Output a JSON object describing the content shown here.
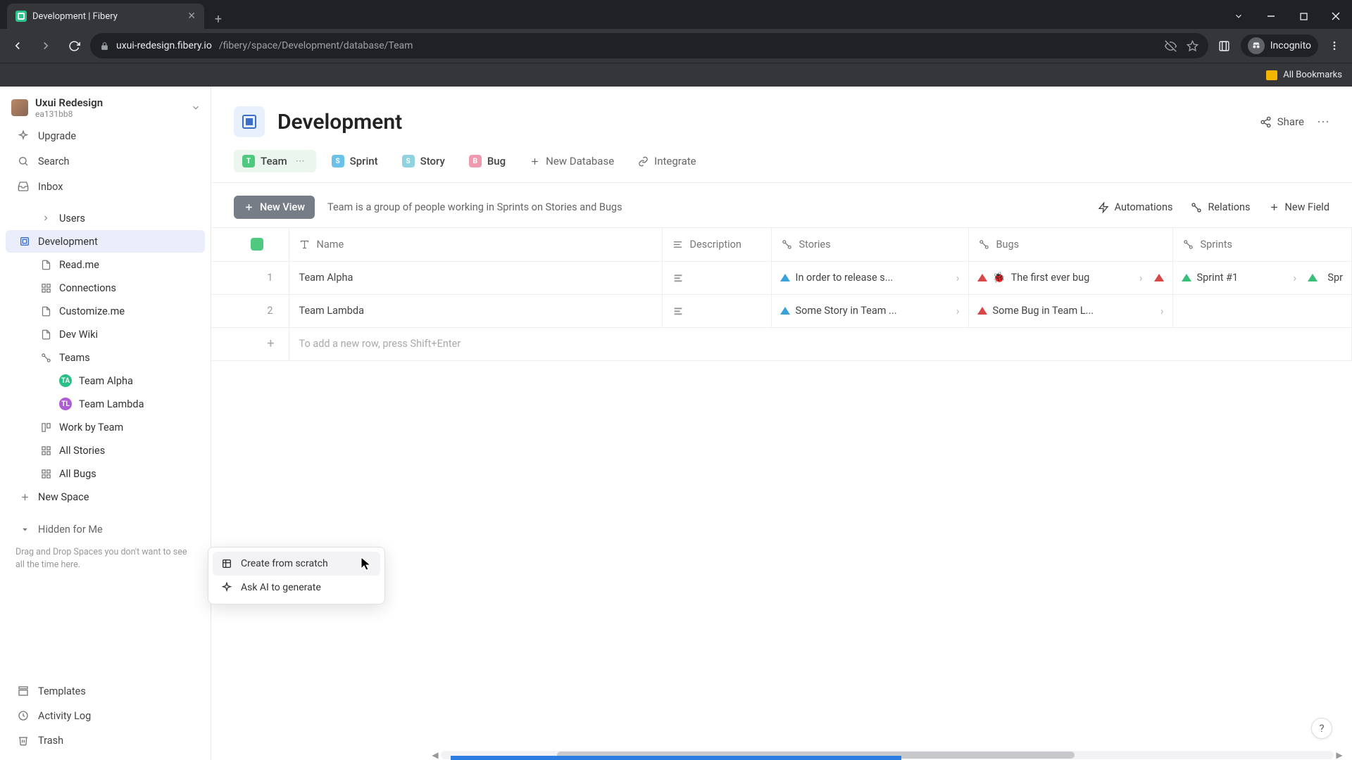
{
  "browser": {
    "tab_title": "Development | Fibery",
    "url_host": "uxui-redesign.fibery.io",
    "url_path": "/fibery/space/Development/database/Team",
    "incognito_label": "Incognito",
    "bookmarks_label": "All Bookmarks"
  },
  "workspace": {
    "name": "Uxui Redesign",
    "id": "ea131bb8"
  },
  "sidebar": {
    "upgrade": "Upgrade",
    "search": "Search",
    "inbox": "Inbox",
    "users": "Users",
    "development": "Development",
    "readme": "Read.me",
    "connections": "Connections",
    "customize": "Customize.me",
    "wiki": "Dev Wiki",
    "teams": "Teams",
    "team_alpha": "Team Alpha",
    "team_lambda": "Team Lambda",
    "work_by_team": "Work by Team",
    "all_stories": "All Stories",
    "all_bugs": "All Bugs",
    "new_space": "New Space",
    "hidden": "Hidden for Me",
    "hidden_help": "Drag and Drop Spaces you don't want to see all the time here.",
    "templates": "Templates",
    "activity": "Activity Log",
    "trash": "Trash"
  },
  "popup": {
    "create": "Create from scratch",
    "ai": "Ask AI to generate"
  },
  "page": {
    "title": "Development",
    "share": "Share"
  },
  "tabs": {
    "team": "Team",
    "sprint": "Sprint",
    "story": "Story",
    "bug": "Bug",
    "new_db": "New Database",
    "integrate": "Integrate"
  },
  "toolbar": {
    "new_view": "New View",
    "desc": "Team is a group of people working in Sprints on Stories and Bugs",
    "automations": "Automations",
    "relations": "Relations",
    "new_field": "New Field"
  },
  "columns": {
    "name": "Name",
    "description": "Description",
    "stories": "Stories",
    "bugs": "Bugs",
    "sprints": "Sprints"
  },
  "rows": [
    {
      "num": "1",
      "name": "Team Alpha",
      "story": "In order to release s...",
      "bug": "The first ever bug",
      "sprint": "Sprint #1",
      "sprint2": "Spr"
    },
    {
      "num": "2",
      "name": "Team Lambda",
      "story": "Some Story in Team ...",
      "bug": "Some Bug in Team L..."
    }
  ],
  "add_row_hint": "To add a new row, press Shift+Enter"
}
